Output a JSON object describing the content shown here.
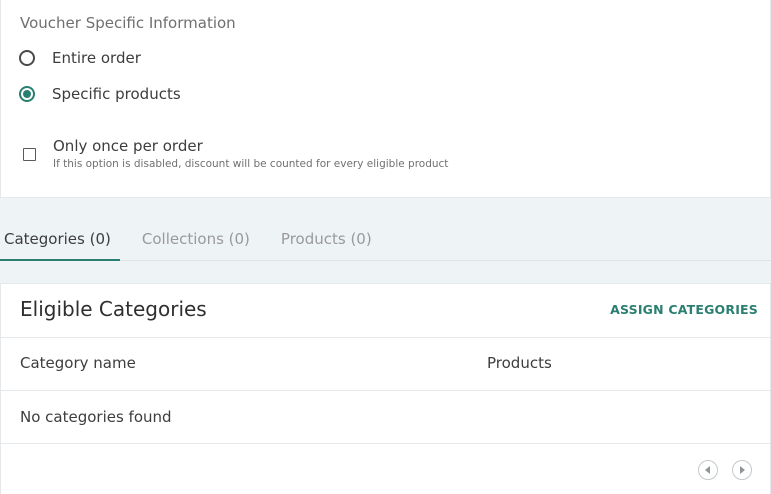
{
  "voucher": {
    "title": "Voucher Specific Information",
    "options": [
      {
        "label": "Entire order",
        "selected": false
      },
      {
        "label": "Specific products",
        "selected": true
      }
    ],
    "once_per_order": {
      "label": "Only once per order",
      "help": "If this option is disabled, discount will be counted for every eligible product",
      "checked": false
    }
  },
  "tabs": [
    {
      "label": "Categories (0)",
      "active": true
    },
    {
      "label": "Collections (0)",
      "active": false
    },
    {
      "label": "Products (0)",
      "active": false
    }
  ],
  "categories": {
    "title": "Eligible Categories",
    "assign_label": "ASSIGN CATEGORIES",
    "columns": [
      "Category name",
      "Products"
    ],
    "empty_text": "No categories found"
  },
  "pagination": {
    "prev_icon": "chevron-left-icon",
    "next_icon": "chevron-right-icon"
  },
  "colors": {
    "accent": "#2a7f70",
    "page_background": "#eef3f6"
  }
}
